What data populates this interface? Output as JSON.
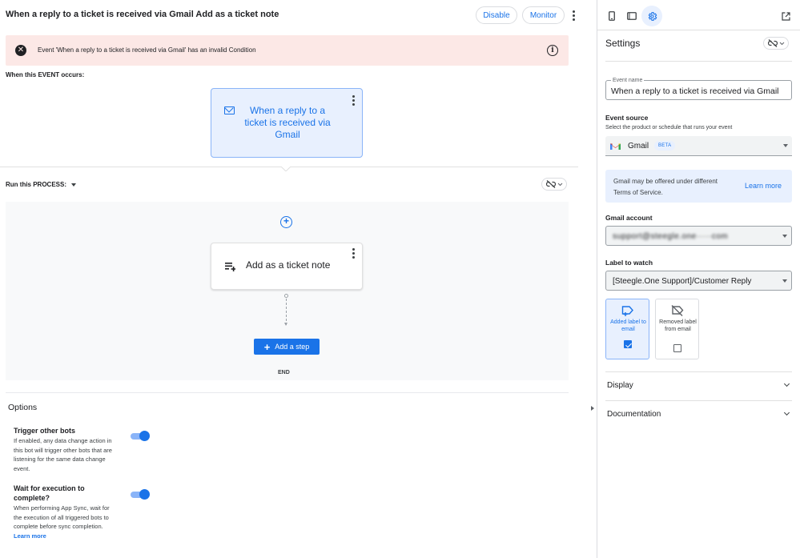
{
  "header": {
    "title": "When a reply to a ticket is received via Gmail Add as a ticket note",
    "disable_label": "Disable",
    "monitor_label": "Monitor"
  },
  "error_banner": {
    "message": "Event 'When a reply to a ticket is received via Gmail' has an invalid Condition"
  },
  "event_section": {
    "label": "When this EVENT occurs:",
    "card_text": "When a reply to a ticket is received via Gmail"
  },
  "process_section": {
    "label": "Run this PROCESS:",
    "step_label": "Add as a ticket note",
    "add_step_label": "Add a step",
    "end_label": "END"
  },
  "options": {
    "title": "Options",
    "items": [
      {
        "title": "Trigger other bots",
        "description": "If enabled, any data change action in this bot will trigger other bots that are listening for the same data change event.",
        "enabled": true
      },
      {
        "title": "Wait for execution to complete?",
        "description": "When performing App Sync, wait for the execution of all triggered bots to complete before sync completion.",
        "link": "Learn more",
        "enabled": true
      }
    ]
  },
  "settings": {
    "title": "Settings",
    "event_name": {
      "label": "Event name",
      "value": "When a reply to a ticket is received via Gmail"
    },
    "event_source": {
      "heading": "Event source",
      "subtext": "Select the product or schedule that runs your event",
      "value": "Gmail",
      "badge": "BETA"
    },
    "info": {
      "text": "Gmail may be offered under different Terms of Service.",
      "link": "Learn more"
    },
    "gmail_account": {
      "heading": "Gmail account",
      "value": "support@steegle.one·····com"
    },
    "label_to_watch": {
      "heading": "Label to watch",
      "value": "[Steegle.One Support]/Customer Reply"
    },
    "label_options": [
      {
        "label": "Added label to email",
        "checked": true
      },
      {
        "label": "Removed label from email",
        "checked": false
      }
    ],
    "sections": [
      {
        "title": "Display"
      },
      {
        "title": "Documentation"
      }
    ]
  },
  "colors": {
    "accent": "#1a73e8",
    "error_bg": "#fce8e6",
    "card_bg": "#e8f0fe",
    "process_bg": "#f8f9fa"
  }
}
